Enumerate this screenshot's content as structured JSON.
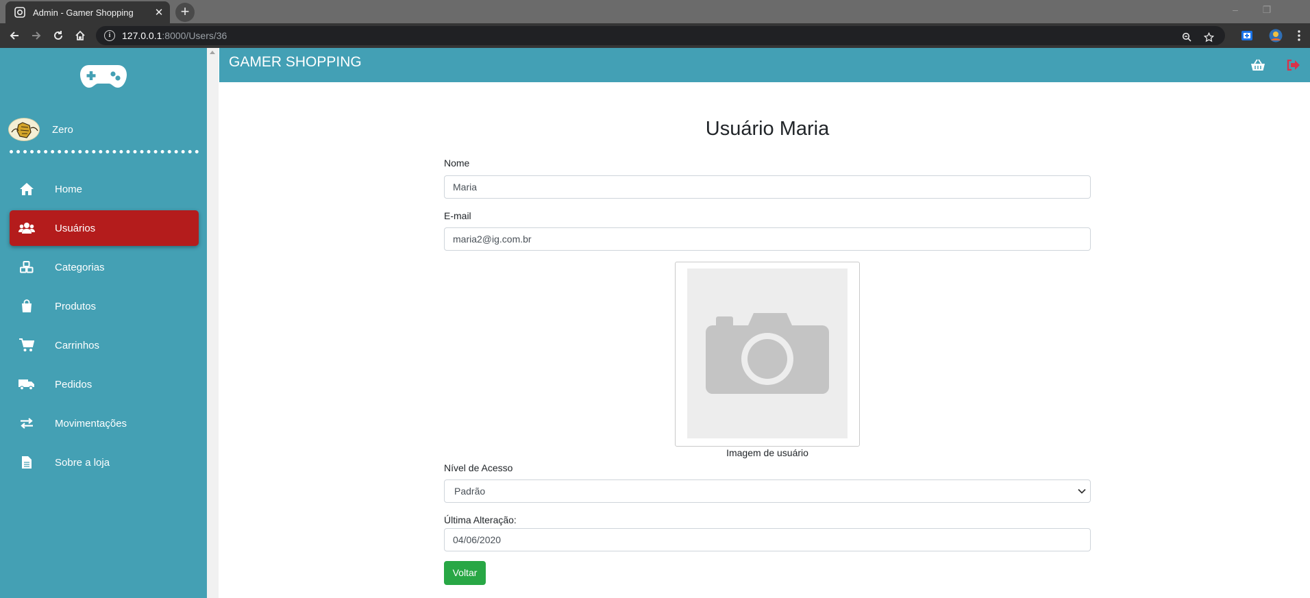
{
  "browser": {
    "tab_title": "Admin - Gamer Shopping",
    "tab_close": "✕",
    "new_tab": "+",
    "url_host": "127.0.0.1",
    "url_rest": ":8000/Users/36",
    "window_controls": [
      "–",
      "❐"
    ]
  },
  "sidebar": {
    "profile_name": "Zero",
    "items": [
      {
        "label": "Home",
        "icon": "home-icon"
      },
      {
        "label": "Usuários",
        "icon": "users-icon"
      },
      {
        "label": "Categorias",
        "icon": "boxes-icon"
      },
      {
        "label": "Produtos",
        "icon": "shopping-bag-icon"
      },
      {
        "label": "Carrinhos",
        "icon": "cart-icon"
      },
      {
        "label": "Pedidos",
        "icon": "truck-icon"
      },
      {
        "label": "Movimentações",
        "icon": "exchange-icon"
      },
      {
        "label": "Sobre a loja",
        "icon": "file-icon"
      }
    ],
    "active_item": "Usuários"
  },
  "header": {
    "brand": "GAMER SHOPPING",
    "icons": [
      "basket-icon",
      "sign-out-icon"
    ]
  },
  "form": {
    "title": "Usuário Maria",
    "name_label": "Nome",
    "name_value": "Maria",
    "email_label": "E-mail",
    "email_value": "maria2@ig.com.br",
    "image_caption": "Imagem de usuário",
    "access_label": "Nível de Acesso",
    "access_value": "Padrão",
    "updated_label": "Última Alteração:",
    "updated_value": "04/06/2020",
    "back_button": "Voltar"
  },
  "colors": {
    "sidebar": "#44a0b4",
    "header": "#43a0b5",
    "active_item": "#b41c1c",
    "back_button": "#28a745",
    "logout_icon": "#d9324a"
  }
}
